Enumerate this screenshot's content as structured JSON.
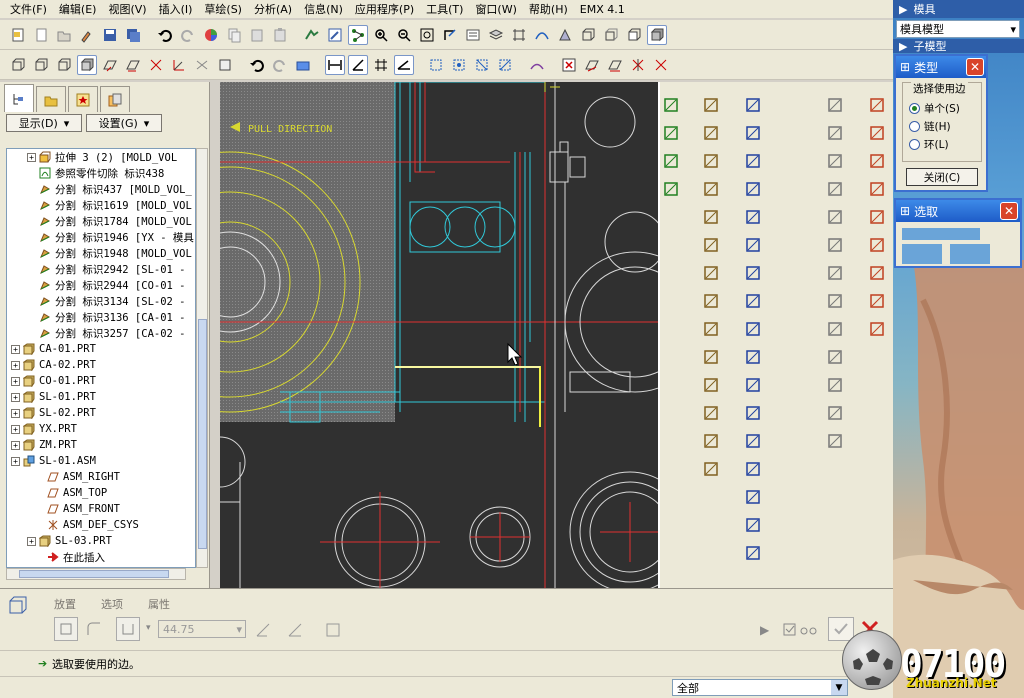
{
  "menu": [
    "文件(F)",
    "编辑(E)",
    "视图(V)",
    "插入(I)",
    "草绘(S)",
    "分析(A)",
    "信息(N)",
    "应用程序(P)",
    "工具(T)",
    "窗口(W)",
    "帮助(H)",
    "EMX 4.1"
  ],
  "left_panel": {
    "show_btn": "显示(D)",
    "settings_btn": "设置(G)",
    "tree": [
      {
        "label": "拉伸 3 (2) [MOLD_VOL",
        "indent": 2,
        "plus": true,
        "icon": "extrude-icon"
      },
      {
        "label": "参照零件切除 标识438",
        "indent": 2,
        "plus": false,
        "icon": "cut-icon"
      },
      {
        "label": "分割 标识437 [MOLD_VOL_",
        "indent": 2,
        "plus": false,
        "icon": "split-icon"
      },
      {
        "label": "分割 标识1619 [MOLD_VOL",
        "indent": 2,
        "plus": false,
        "icon": "split-icon"
      },
      {
        "label": "分割 标识1784 [MOLD_VOL",
        "indent": 2,
        "plus": false,
        "icon": "split-icon"
      },
      {
        "label": "分割 标识1946 [YX - 模具",
        "indent": 2,
        "plus": false,
        "icon": "split-icon"
      },
      {
        "label": "分割 标识1948 [MOLD_VOL",
        "indent": 2,
        "plus": false,
        "icon": "split-icon"
      },
      {
        "label": "分割 标识2942 [SL-01 -",
        "indent": 2,
        "plus": false,
        "icon": "split-icon"
      },
      {
        "label": "分割 标识2944 [CO-01 -",
        "indent": 2,
        "plus": false,
        "icon": "split-icon"
      },
      {
        "label": "分割 标识3134 [SL-02 -",
        "indent": 2,
        "plus": false,
        "icon": "split-icon"
      },
      {
        "label": "分割 标识3136 [CA-01 -",
        "indent": 2,
        "plus": false,
        "icon": "split-icon"
      },
      {
        "label": "分割 标识3257 [CA-02 -",
        "indent": 2,
        "plus": false,
        "icon": "split-icon"
      },
      {
        "label": "CA-01.PRT",
        "indent": 0,
        "plus": true,
        "icon": "part-icon"
      },
      {
        "label": "CA-02.PRT",
        "indent": 0,
        "plus": true,
        "icon": "part-icon"
      },
      {
        "label": "CO-01.PRT",
        "indent": 0,
        "plus": true,
        "icon": "part-icon"
      },
      {
        "label": "SL-01.PRT",
        "indent": 0,
        "plus": true,
        "icon": "part-icon"
      },
      {
        "label": "SL-02.PRT",
        "indent": 0,
        "plus": true,
        "icon": "part-icon"
      },
      {
        "label": "YX.PRT",
        "indent": 0,
        "plus": true,
        "icon": "part-icon"
      },
      {
        "label": "ZM.PRT",
        "indent": 0,
        "plus": true,
        "icon": "part-icon"
      },
      {
        "label": "SL-01.ASM",
        "indent": 0,
        "plus": true,
        "icon": "assembly-icon"
      },
      {
        "label": "ASM_RIGHT",
        "indent": 3,
        "plus": false,
        "icon": "datum-plane-icon"
      },
      {
        "label": "ASM_TOP",
        "indent": 3,
        "plus": false,
        "icon": "datum-plane-icon"
      },
      {
        "label": "ASM_FRONT",
        "indent": 3,
        "plus": false,
        "icon": "datum-plane-icon"
      },
      {
        "label": "ASM_DEF_CSYS",
        "indent": 3,
        "plus": false,
        "icon": "csys-icon"
      },
      {
        "label": "SL-03.PRT",
        "indent": 2,
        "plus": true,
        "icon": "part-icon"
      },
      {
        "label": "在此插入",
        "indent": 3,
        "plus": false,
        "icon": "insert-here-icon"
      }
    ]
  },
  "canvas": {
    "annotation": "PULL DIRECTION"
  },
  "dashboard": {
    "tab_place": "放置",
    "tab_options": "选项",
    "tab_props": "属性",
    "value": "44.75"
  },
  "status_message": "选取要使用的边。",
  "filter_label": "全部",
  "right_panel": {
    "title1": "模具",
    "combo": "模具模型",
    "title2": "子模型"
  },
  "dialog_type": {
    "title": "类型",
    "group": "选择使用边",
    "options": [
      "单个(S)",
      "链(H)",
      "环(L)"
    ],
    "close": "关闭(C)"
  },
  "dialog_select": {
    "title": "选取"
  },
  "watermark": {
    "number": "07100",
    "site": "Zhuanzhi.Net"
  }
}
